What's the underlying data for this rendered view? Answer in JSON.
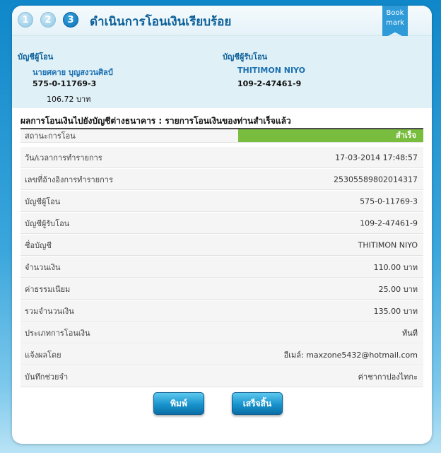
{
  "header": {
    "steps": [
      "1",
      "2",
      "3"
    ],
    "title": "ดำเนินการโอนเงินเรียบร้อย",
    "bookmark_line1": "Book",
    "bookmark_line2": "mark"
  },
  "from_account": {
    "label": "บัญชีผู้โอน",
    "name": "นายศคาย บุญสงวนศิลป์",
    "number": "575-0-11769-3",
    "balance": "106.72 บาท"
  },
  "to_account": {
    "label": "บัญชีผู้รับโอน",
    "name": "THITIMON NIYO",
    "number": "109-2-47461-9"
  },
  "result": {
    "title": "ผลการโอนเงินไปยังบัญชีต่างธนาคาร : รายการโอนเงินของท่านสำเร็จแล้ว",
    "status_label": "สถานะการโอน",
    "status_value": "สำเร็จ",
    "rows": [
      {
        "label": "วัน/เวลาการทำรายการ",
        "value": "17-03-2014 17:48:57"
      },
      {
        "label": "เลขที่อ้างอิงการทำรายการ",
        "value": "25305589802014317"
      },
      {
        "label": "บัญชีผู้โอน",
        "value": "575-0-11769-3"
      },
      {
        "label": "บัญชีผู้รับโอน",
        "value": "109-2-47461-9"
      },
      {
        "label": "ชื่อบัญชี",
        "value": "THITIMON NIYO"
      },
      {
        "label": "จำนวนเงิน",
        "value": "110.00 บาท"
      },
      {
        "label": "ค่าธรรมเนียม",
        "value": "25.00 บาท"
      },
      {
        "label": "รวมจำนวนเงิน",
        "value": "135.00 บาท"
      },
      {
        "label": "ประเภทการโอนเงิน",
        "value": "ทันที"
      },
      {
        "label": "แจ้งผลโดย",
        "value": "อีเมล์: maxzone5432@hotmail.com"
      },
      {
        "label": "บันทึกช่วยจำ",
        "value": "ค่าชากาปองไทกะ"
      }
    ]
  },
  "buttons": {
    "print": "พิมพ์",
    "finish": "เสร็จสิ้น"
  },
  "colors": {
    "accent": "#0b5f99",
    "status_success": "#78bd3d",
    "button": "#1793cd"
  }
}
